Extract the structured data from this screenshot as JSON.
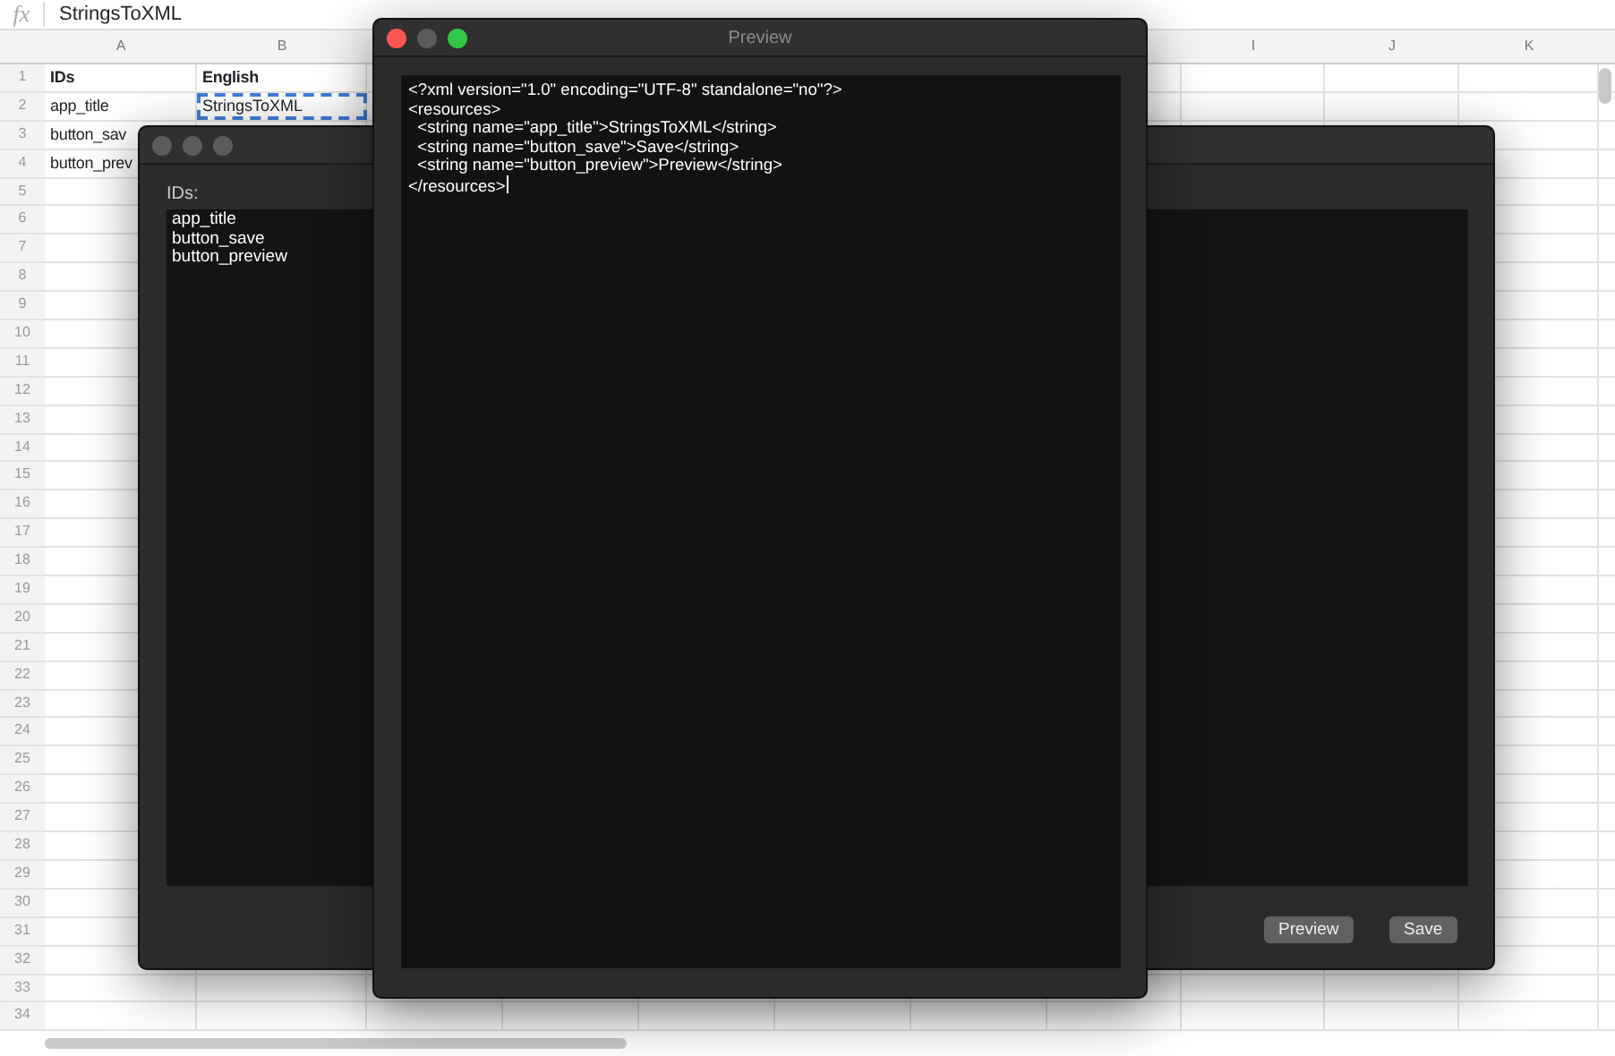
{
  "formula_bar": {
    "fx_label": "fx",
    "value": "StringsToXML"
  },
  "sheet": {
    "columns": [
      "A",
      "B",
      "I",
      "J",
      "K"
    ],
    "rows": [
      {
        "number": "1",
        "kind": "header",
        "cells": [
          {
            "text": "IDs",
            "selected": false
          },
          {
            "text": "English",
            "selected": false
          }
        ]
      },
      {
        "number": "2",
        "kind": "data",
        "cells": [
          {
            "text": "app_title",
            "selected": false
          },
          {
            "text": "StringsToXML",
            "selected": true
          }
        ]
      },
      {
        "number": "3",
        "kind": "data",
        "cells": [
          {
            "text": "button_sav",
            "selected": false
          }
        ]
      },
      {
        "number": "4",
        "kind": "data",
        "cells": [
          {
            "text": "button_prev",
            "selected": false
          }
        ]
      },
      {
        "number": "5"
      },
      {
        "number": "6"
      },
      {
        "number": "7"
      },
      {
        "number": "8"
      },
      {
        "number": "9"
      },
      {
        "number": "10"
      },
      {
        "number": "11"
      },
      {
        "number": "12"
      },
      {
        "number": "13"
      },
      {
        "number": "14"
      },
      {
        "number": "15"
      },
      {
        "number": "16"
      },
      {
        "number": "17"
      },
      {
        "number": "18"
      },
      {
        "number": "19"
      },
      {
        "number": "20"
      },
      {
        "number": "21"
      },
      {
        "number": "22"
      },
      {
        "number": "23"
      },
      {
        "number": "24"
      },
      {
        "number": "25"
      },
      {
        "number": "26"
      },
      {
        "number": "27"
      },
      {
        "number": "28"
      },
      {
        "number": "29"
      },
      {
        "number": "30"
      },
      {
        "number": "31"
      },
      {
        "number": "32"
      },
      {
        "number": "33"
      },
      {
        "number": "34"
      }
    ]
  },
  "main_window": {
    "lights": [
      {
        "color": "#5b5b5b"
      },
      {
        "color": "#5b5b5b"
      },
      {
        "color": "#5b5b5b"
      }
    ],
    "label": "IDs:",
    "ids": [
      "app_title",
      "button_save",
      "button_preview"
    ],
    "buttons": [
      "Preview",
      "Save"
    ]
  },
  "preview_window": {
    "title": "Preview",
    "lights": [
      {
        "color": "#fc5753"
      },
      {
        "color": "#5b5b5b"
      },
      {
        "color": "#33c748"
      }
    ],
    "lines": [
      "<?xml version=\"1.0\" encoding=\"UTF-8\" standalone=\"no\"?>",
      "<resources>",
      "  <string name=\"app_title\">StringsToXML</string>",
      "  <string name=\"button_save\">Save</string>",
      "  <string name=\"button_preview\">Preview</string>",
      "</resources>"
    ],
    "cursor_at_end": true
  }
}
